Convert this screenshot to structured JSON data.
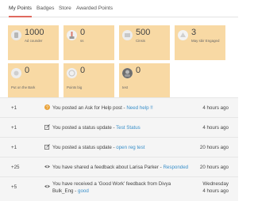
{
  "tabs": [
    "My Points",
    "Badges",
    "Store",
    "Awarded Points"
  ],
  "tiles": [
    {
      "value": "1000",
      "label": "Ad counder"
    },
    {
      "value": "0",
      "label": "ss"
    },
    {
      "value": "500",
      "label": "Cinsis"
    },
    {
      "value": "3",
      "label": "May sbir Engaged"
    },
    {
      "value": "0",
      "label": "Put on the Bark"
    },
    {
      "value": "0",
      "label": "Points big"
    },
    {
      "value": "0",
      "label": "test"
    }
  ],
  "activity": [
    {
      "points": "+1",
      "icon": "question-circle-icon",
      "text": "You posted an Ask for Help post -",
      "link": "Need help !!",
      "time": "4 hours ago"
    },
    {
      "points": "+1",
      "icon": "edit-icon",
      "text": "You posted a status update -",
      "link": "Test Status",
      "time": "4 hours ago"
    },
    {
      "points": "+1",
      "icon": "edit-icon",
      "text": "You posted a status update -",
      "link": "open reg test",
      "time": "20 hours ago"
    },
    {
      "points": "+25",
      "icon": "eye-icon",
      "text": "You have shared a feedback about Larisa Parker -",
      "link": "Responded",
      "time": "20 hours ago"
    },
    {
      "points": "+5",
      "icon": "eye-icon",
      "text_line1": "You have received a 'Good Work' feedback from Divya",
      "text_line2": "Bulk_Eng -",
      "link": "good",
      "time_line1": "Wednesday",
      "time_line2": "4 hours ago"
    }
  ],
  "colors": {
    "tile_bg": "#f8d9a4",
    "active_tab_underline": "#e06a5f",
    "link": "#3a8fc9",
    "question_icon": "#e9a33b"
  }
}
